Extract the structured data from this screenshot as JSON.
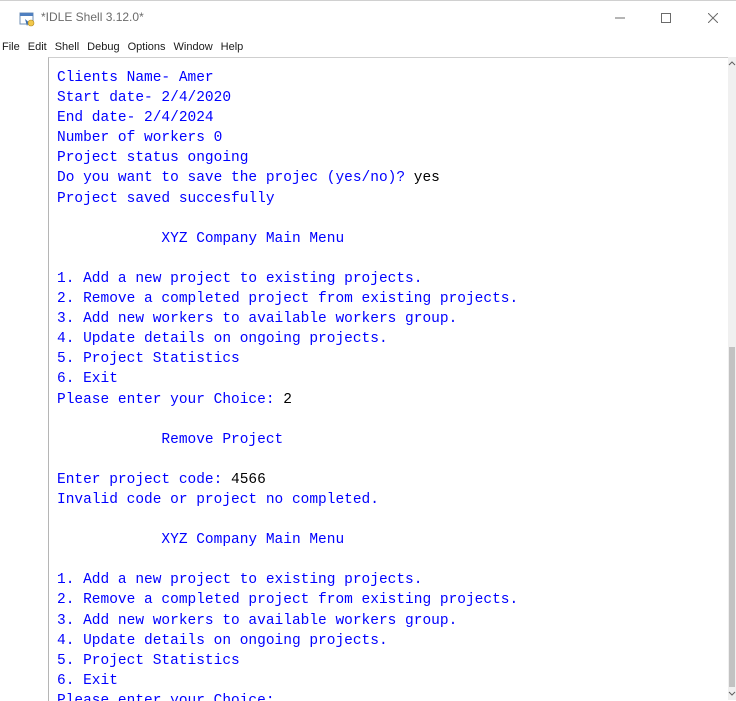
{
  "window": {
    "title": "*IDLE Shell 3.12.0*",
    "controls": [
      "minimize",
      "maximize",
      "close"
    ]
  },
  "menu": {
    "items": [
      "File",
      "Edit",
      "Shell",
      "Debug",
      "Options",
      "Window",
      "Help"
    ]
  },
  "shell": {
    "lines": [
      {
        "text": "Clients Name- Amer",
        "input": ""
      },
      {
        "text": "Start date- 2/4/2020",
        "input": ""
      },
      {
        "text": "End date- 2/4/2024",
        "input": ""
      },
      {
        "text": "Number of workers 0",
        "input": ""
      },
      {
        "text": "Project status ongoing",
        "input": ""
      },
      {
        "text": "Do you want to save the projec (yes/no)? ",
        "input": "yes"
      },
      {
        "text": "Project saved succesfully",
        "input": ""
      },
      {
        "text": "",
        "input": ""
      },
      {
        "text": "            XYZ Company Main Menu",
        "input": ""
      },
      {
        "text": "",
        "input": ""
      },
      {
        "text": "1. Add a new project to existing projects.",
        "input": ""
      },
      {
        "text": "2. Remove a completed project from existing projects.",
        "input": ""
      },
      {
        "text": "3. Add new workers to available workers group.",
        "input": ""
      },
      {
        "text": "4. Update details on ongoing projects.",
        "input": ""
      },
      {
        "text": "5. Project Statistics",
        "input": ""
      },
      {
        "text": "6. Exit",
        "input": ""
      },
      {
        "text": "Please enter your Choice: ",
        "input": "2"
      },
      {
        "text": "",
        "input": ""
      },
      {
        "text": "            Remove Project",
        "input": ""
      },
      {
        "text": "",
        "input": ""
      },
      {
        "text": "Enter project code: ",
        "input": "4566"
      },
      {
        "text": "Invalid code or project no completed.",
        "input": ""
      },
      {
        "text": "",
        "input": ""
      },
      {
        "text": "            XYZ Company Main Menu",
        "input": ""
      },
      {
        "text": "",
        "input": ""
      },
      {
        "text": "1. Add a new project to existing projects.",
        "input": ""
      },
      {
        "text": "2. Remove a completed project from existing projects.",
        "input": ""
      },
      {
        "text": "3. Add new workers to available workers group.",
        "input": ""
      },
      {
        "text": "4. Update details on ongoing projects.",
        "input": ""
      },
      {
        "text": "5. Project Statistics",
        "input": ""
      },
      {
        "text": "6. Exit",
        "input": ""
      },
      {
        "text": "Please enter your Choice: ",
        "input": ""
      }
    ]
  },
  "colors": {
    "output": "#0000ff",
    "input": "#000000"
  }
}
